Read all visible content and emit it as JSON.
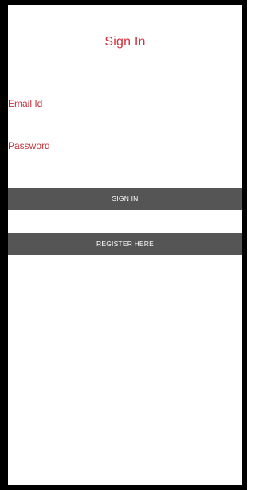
{
  "screen": {
    "title": "Sign In"
  },
  "form": {
    "email_label": "Email Id",
    "password_label": "Password"
  },
  "buttons": {
    "sign_in": "SIGN IN",
    "register": "REGISTER HERE"
  },
  "colors": {
    "accent": "#d32f3a",
    "button_bg": "#555555",
    "button_text": "#ffffff",
    "frame": "#000000"
  }
}
